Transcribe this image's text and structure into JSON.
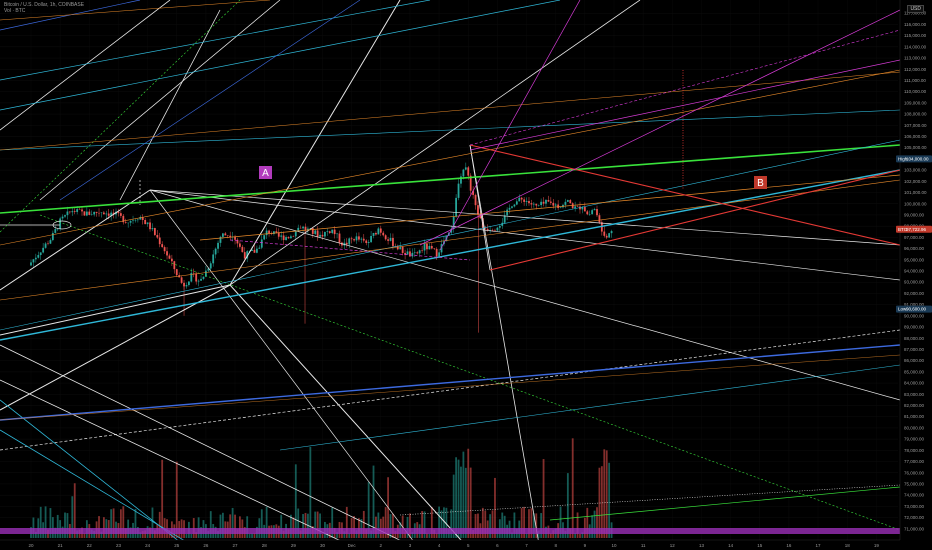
{
  "header": {
    "symbol_line": "Bitcoin / U.S. Dollar, 1h, COINBASE",
    "sub_line": "Vol · BTC"
  },
  "currency": "USD",
  "annotations": {
    "label_a": "A",
    "label_b": "B"
  },
  "price_tags": {
    "high": {
      "label": "High",
      "value": "104,000.00"
    },
    "last": {
      "label": "BTC",
      "value": "97,722.96"
    },
    "low": {
      "label": "Low",
      "value": "90,600.00"
    }
  },
  "colors": {
    "background": "#000000",
    "bull": "#26a69a",
    "bear": "#ef5350",
    "white_line": "#e8e8e8",
    "green_line": "#39e23b",
    "cyan_line": "#2fb8d8",
    "red_line": "#e53935",
    "magenta_line": "#d63bd6",
    "orange_line": "#e88a2a",
    "blue_line": "#3d6ae0",
    "purple_band": "#9b30b8",
    "label_a_bg": "#b23bbd",
    "label_b_bg": "#c0392b"
  },
  "chart_data": {
    "type": "candlestick",
    "title": "Bitcoin / U.S. Dollar, 1h, COINBASE",
    "price_axis": {
      "ylim": [
        70000,
        118000
      ],
      "ticks": [
        "117,000.00",
        "116,000.00",
        "115,000.00",
        "114,000.00",
        "113,000.00",
        "112,000.00",
        "111,000.00",
        "110,000.00",
        "109,000.00",
        "108,000.00",
        "107,000.00",
        "106,000.00",
        "105,000.00",
        "104,000.00",
        "103,000.00",
        "102,000.00",
        "101,000.00",
        "100,000.00",
        "99,000.00",
        "98,000.00",
        "97,000.00",
        "96,000.00",
        "95,000.00",
        "94,000.00",
        "93,000.00",
        "92,000.00",
        "91,000.00",
        "90,000.00",
        "89,000.00",
        "88,000.00",
        "87,000.00",
        "86,000.00",
        "85,000.00",
        "84,000.00",
        "83,000.00",
        "82,000.00",
        "81,000.00",
        "80,000.00",
        "79,000.00",
        "78,000.00",
        "77,000.00",
        "76,000.00",
        "75,000.00",
        "74,000.00",
        "73,000.00",
        "72,000.00",
        "71,000.00"
      ]
    },
    "time_axis": {
      "ticks": [
        "20",
        "21",
        "22",
        "23",
        "24",
        "25",
        "26",
        "27",
        "28",
        "29",
        "30",
        "Dec",
        "2",
        "3",
        "4",
        "5",
        "6",
        "7",
        "8",
        "9",
        "10",
        "11",
        "12",
        "13",
        "14",
        "15",
        "16",
        "17",
        "18",
        "19"
      ]
    },
    "price_path": [
      [
        0,
        94500
      ],
      [
        0.4,
        95800
      ],
      [
        0.8,
        97000
      ],
      [
        1.1,
        98500
      ],
      [
        1.5,
        99400
      ],
      [
        2.0,
        99100
      ],
      [
        2.5,
        99300
      ],
      [
        3.0,
        99000
      ],
      [
        3.4,
        98400
      ],
      [
        3.8,
        98900
      ],
      [
        4.2,
        97800
      ],
      [
        4.6,
        96200
      ],
      [
        5.0,
        94200
      ],
      [
        5.3,
        92700
      ],
      [
        5.6,
        93600
      ],
      [
        5.9,
        93100
      ],
      [
        6.2,
        94600
      ],
      [
        6.6,
        97200
      ],
      [
        7.0,
        97300
      ],
      [
        7.4,
        95400
      ],
      [
        7.8,
        95800
      ],
      [
        8.2,
        97600
      ],
      [
        8.6,
        97000
      ],
      [
        9.0,
        97100
      ],
      [
        9.3,
        98000
      ],
      [
        9.7,
        97500
      ],
      [
        10.0,
        97200
      ],
      [
        10.4,
        97700
      ],
      [
        10.8,
        96300
      ],
      [
        11.2,
        97000
      ],
      [
        11.6,
        96400
      ],
      [
        12.0,
        97800
      ],
      [
        12.4,
        96700
      ],
      [
        12.8,
        95800
      ],
      [
        13.2,
        95300
      ],
      [
        13.6,
        96200
      ],
      [
        14.0,
        95600
      ],
      [
        14.5,
        97600
      ],
      [
        14.8,
        102600
      ],
      [
        15.0,
        103400
      ],
      [
        15.2,
        101000
      ],
      [
        15.4,
        99300
      ],
      [
        15.6,
        97800
      ],
      [
        16.0,
        97900
      ],
      [
        16.3,
        98600
      ],
      [
        16.6,
        100100
      ],
      [
        17.0,
        100400
      ],
      [
        17.4,
        99700
      ],
      [
        17.8,
        100100
      ],
      [
        18.2,
        99800
      ],
      [
        18.5,
        100200
      ],
      [
        18.8,
        99500
      ],
      [
        19.0,
        99900
      ],
      [
        19.2,
        98900
      ],
      [
        19.4,
        99700
      ],
      [
        19.6,
        98100
      ],
      [
        19.8,
        97200
      ],
      [
        20.0,
        97700
      ]
    ],
    "high_marker": 104000,
    "last_price": 97722.96,
    "low_marker": 90600
  }
}
